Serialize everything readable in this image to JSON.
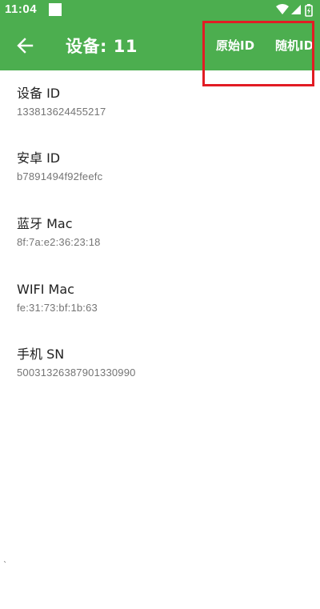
{
  "status_bar": {
    "time": "11:04"
  },
  "toolbar": {
    "back_icon": "arrow-back-icon",
    "title": "设备: 11",
    "actions": [
      {
        "label": "原始ID"
      },
      {
        "label": "随机ID"
      }
    ]
  },
  "colors": {
    "primary": "#4cae4f",
    "highlight": "#e21c24",
    "label_text": "#212121",
    "value_text": "#757575"
  },
  "items": [
    {
      "label": "设备 ID",
      "value": "133813624455217"
    },
    {
      "label": "安卓 ID",
      "value": "b7891494f92feefc"
    },
    {
      "label": "蓝牙 Mac",
      "value": "8f:7a:e2:36:23:18"
    },
    {
      "label": "WIFI Mac",
      "value": "fe:31:73:bf:1b:63"
    },
    {
      "label": "手机 SN",
      "value": "50031326387901330990"
    }
  ],
  "stray_mark": "`"
}
